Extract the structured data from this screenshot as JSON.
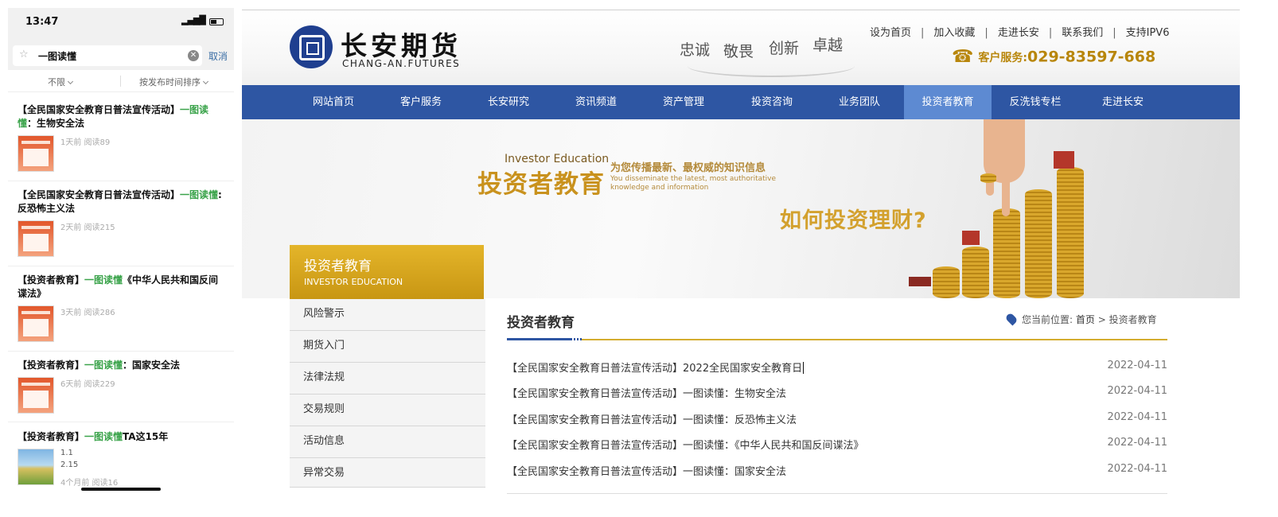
{
  "phone": {
    "time": "13:47",
    "search_query": "一图读懂",
    "cancel_label": "取消",
    "filter_all": "不限",
    "filter_sort": "按发布时间排序",
    "results": [
      {
        "title_before": "【全民国家安全教育日普法宣传活动】",
        "title_highlight": "一图读懂",
        "title_after": "：生物安全法",
        "meta": "1天前  阅读89"
      },
      {
        "title_before": "【全民国家安全教育日普法宣传活动】",
        "title_highlight": "一图读懂",
        "title_after": ":反恐怖主义法",
        "meta": "2天前  阅读215"
      },
      {
        "title_before": "【投资者教育】",
        "title_highlight": "一图读懂",
        "title_after": "《中华人民共和国反间谍法》",
        "meta": "3天前  阅读286"
      },
      {
        "title_before": "【投资者教育】",
        "title_highlight": "一图读懂",
        "title_after": "：国家安全法",
        "meta": "6天前  阅读229"
      },
      {
        "title_before": "【投资者教育】",
        "title_highlight": "一图读懂",
        "title_after": "TA这15年",
        "extra1": "1.1",
        "extra2": "2.15",
        "meta": "4个月前  阅读16"
      }
    ]
  },
  "site": {
    "logo_cn": "长安期货",
    "logo_en": "CHANG-AN.FUTURES",
    "slogans": [
      "忠诚",
      "敬畏",
      "创新",
      "卓越"
    ],
    "top_links": [
      "设为首页",
      "加入收藏",
      "走进长安",
      "联系我们",
      "支持IPV6"
    ],
    "hotline_label": "客户服务:",
    "hotline_number": "029-83597-668",
    "nav": [
      "网站首页",
      "客户服务",
      "长安研究",
      "资讯频道",
      "资产管理",
      "投资咨询",
      "业务团队",
      "投资者教育",
      "反洗钱专栏",
      "走进长安"
    ],
    "nav_active_index": 7,
    "banner": {
      "en_title": "Investor Education",
      "cn_title": "投资者教育",
      "sub_cn": "为您传播最新、最权威的知识信息",
      "sub_en": "You disseminate the latest, most authoritative knowledge and information",
      "question": "如何投资理财?"
    },
    "sidebar": {
      "title_cn": "投资者教育",
      "title_en": "INVESTOR EDUCATION",
      "items": [
        "风险警示",
        "期货入门",
        "法律法规",
        "交易规则",
        "活动信息",
        "异常交易"
      ]
    },
    "content": {
      "title": "投资者教育",
      "breadcrumb_prefix": "您当前位置:",
      "breadcrumb_home": "首页",
      "breadcrumb_sep": ">",
      "breadcrumb_current": "投资者教育",
      "articles": [
        {
          "title": "【全民国家安全教育日普法宣传活动】2022全民国家安全教育日",
          "date": "2022-04-11"
        },
        {
          "title": "【全民国家安全教育日普法宣传活动】一图读懂：生物安全法",
          "date": "2022-04-11"
        },
        {
          "title": "【全民国家安全教育日普法宣传活动】一图读懂：反恐怖主义法",
          "date": "2022-04-11"
        },
        {
          "title": "【全民国家安全教育日普法宣传活动】一图读懂：《中华人民共和国反间谍法》",
          "date": "2022-04-11"
        },
        {
          "title": "【全民国家安全教育日普法宣传活动】一图读懂：国家安全法",
          "date": "2022-04-11"
        }
      ]
    },
    "colors": {
      "nav_blue": "#2e56a3",
      "nav_active": "#5d8ad2",
      "gold": "#d4ad2f",
      "highlight_green": "#3aa34a"
    }
  }
}
